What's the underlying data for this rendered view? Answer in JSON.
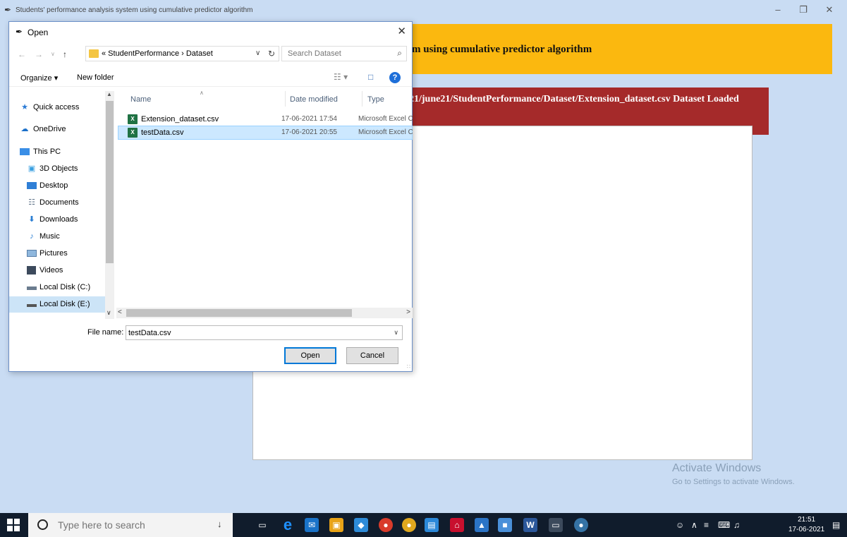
{
  "app": {
    "title": "Students' performance analysis system using cumulative predictor algorithm",
    "header_text": "m using cumulative predictor algorithm",
    "status_text": "21/june21/StudentPerformance/Dataset/Extension_dataset.csv Dataset Loaded",
    "window_controls": [
      "minimize-icon",
      "restore-icon",
      "close-icon"
    ]
  },
  "watermark": {
    "line1": "Activate Windows",
    "line2": "Go to Settings to activate Windows."
  },
  "dialog": {
    "title": "Open",
    "address": {
      "prefix": "«",
      "crumbs": [
        "StudentPerformance",
        "Dataset"
      ],
      "separator": "›",
      "path_text": "« StudentPerformance › Dataset"
    },
    "search_placeholder": "Search Dataset",
    "toolbar": {
      "organize": "Organize ▾",
      "new_folder": "New folder"
    },
    "nav_items": [
      {
        "label": "Quick access",
        "icon": "star-icon"
      },
      {
        "label": "OneDrive",
        "icon": "cloud-icon"
      },
      {
        "label": "This PC",
        "icon": "monitor-icon"
      },
      {
        "label": "3D Objects",
        "icon": "cube-icon"
      },
      {
        "label": "Desktop",
        "icon": "desktop-icon"
      },
      {
        "label": "Documents",
        "icon": "document-icon"
      },
      {
        "label": "Downloads",
        "icon": "download-icon"
      },
      {
        "label": "Music",
        "icon": "music-icon"
      },
      {
        "label": "Pictures",
        "icon": "pictures-icon"
      },
      {
        "label": "Videos",
        "icon": "video-icon"
      },
      {
        "label": "Local Disk (C:)",
        "icon": "drive-icon"
      },
      {
        "label": "Local Disk (E:)",
        "icon": "drive-icon",
        "selected": true
      }
    ],
    "columns": {
      "name": "Name",
      "date": "Date modified",
      "type": "Type"
    },
    "files": [
      {
        "name": "Extension_dataset.csv",
        "date": "17-06-2021 17:54",
        "type": "Microsoft Excel C",
        "icon": "excel-icon",
        "selected": false
      },
      {
        "name": "testData.csv",
        "date": "17-06-2021 20:55",
        "type": "Microsoft Excel C",
        "icon": "excel-icon",
        "selected": true
      }
    ],
    "file_name_label": "File name:",
    "file_name_value": "testData.csv",
    "open_label": "Open",
    "cancel_label": "Cancel"
  },
  "taskbar": {
    "search_placeholder": "Type here to search",
    "time": "21:51",
    "date": "17-06-2021"
  },
  "colors": {
    "header": "#fbb80f",
    "status": "#a52a2a",
    "background": "#c9dcf3",
    "taskbar": "#101c2c"
  }
}
